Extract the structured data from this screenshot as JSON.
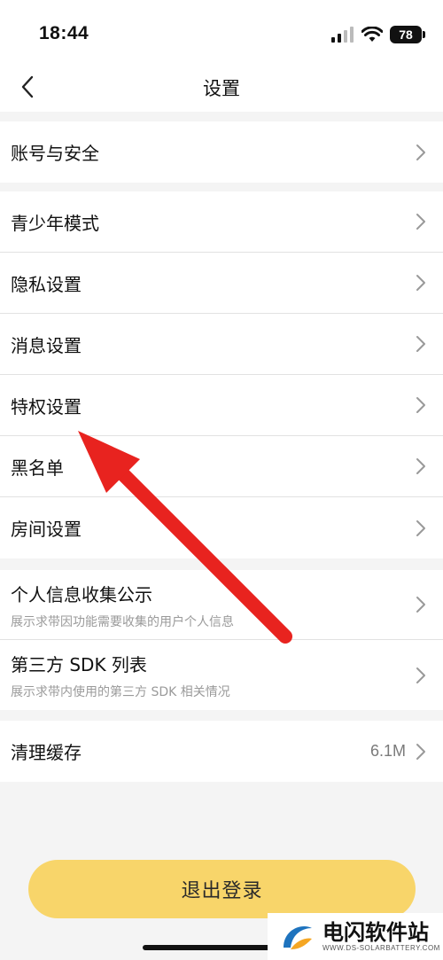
{
  "status": {
    "time": "18:44",
    "battery": "78"
  },
  "nav": {
    "title": "设置"
  },
  "groups": [
    {
      "items": [
        {
          "label": "账号与安全"
        }
      ]
    },
    {
      "items": [
        {
          "label": "青少年模式"
        },
        {
          "label": "隐私设置"
        },
        {
          "label": "消息设置"
        },
        {
          "label": "特权设置"
        },
        {
          "label": "黑名单"
        },
        {
          "label": "房间设置"
        }
      ]
    },
    {
      "items": [
        {
          "label": "个人信息收集公示",
          "sub": "展示求带因功能需要收集的用户个人信息"
        },
        {
          "label": "第三方 SDK 列表",
          "sub": "展示求带内使用的第三方 SDK 相关情况"
        }
      ]
    },
    {
      "items": [
        {
          "label": "清理缓存",
          "value": "6.1M"
        }
      ]
    }
  ],
  "logout": {
    "label": "退出登录"
  },
  "watermark": {
    "title": "电闪软件站",
    "sub": "WWW.DS-SOLARBATTERY.COM"
  },
  "colors": {
    "accent": "#f8d56a",
    "annotation_arrow": "#e8231f"
  }
}
